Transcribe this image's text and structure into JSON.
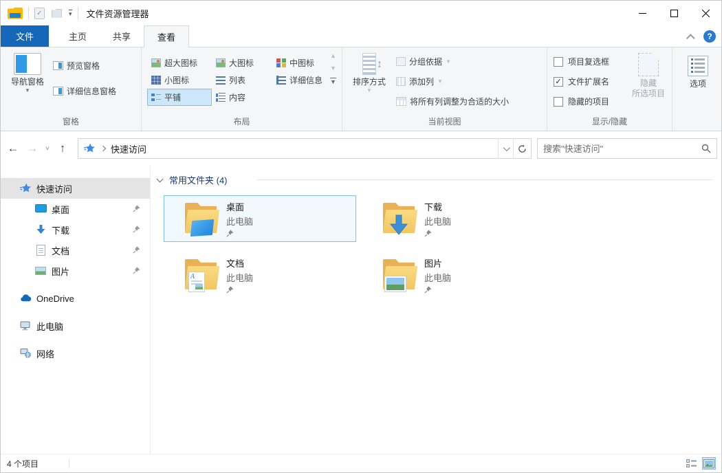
{
  "window": {
    "title": "文件资源管理器"
  },
  "tabs": {
    "file": "文件",
    "home": "主页",
    "share": "共享",
    "view": "查看"
  },
  "ribbon": {
    "panes": {
      "group_label": "窗格",
      "nav_pane": "导航窗格",
      "preview_pane": "预览窗格",
      "details_pane": "详细信息窗格"
    },
    "layout": {
      "group_label": "布局",
      "items": [
        {
          "label": "超大图标"
        },
        {
          "label": "大图标"
        },
        {
          "label": "中图标"
        },
        {
          "label": "小图标"
        },
        {
          "label": "列表"
        },
        {
          "label": "详细信息"
        },
        {
          "label": "平铺"
        },
        {
          "label": "内容"
        }
      ],
      "selected_item": "平铺"
    },
    "current_view": {
      "group_label": "当前视图",
      "sort_by": "排序方式",
      "group_by": "分组依据",
      "add_columns": "添加列",
      "size_columns": "将所有列调整为合适的大小"
    },
    "show_hide": {
      "group_label": "显示/隐藏",
      "item_checkboxes": {
        "label": "项目复选框",
        "checked": false
      },
      "file_extensions": {
        "label": "文件扩展名",
        "checked": true,
        "checkmark": "✓"
      },
      "hidden_items": {
        "label": "隐藏的项目",
        "checked": false
      },
      "hide_selected_line1": "隐藏",
      "hide_selected_line2": "所选项目"
    },
    "options_label": "选项"
  },
  "addressbar": {
    "location": "快速访问",
    "search_placeholder": "搜索\"快速访问\""
  },
  "sidebar": {
    "quick_access": "快速访问",
    "pinned": [
      {
        "label": "桌面"
      },
      {
        "label": "下载"
      },
      {
        "label": "文档"
      },
      {
        "label": "图片"
      }
    ],
    "onedrive": "OneDrive",
    "this_pc": "此电脑",
    "network": "网络"
  },
  "main": {
    "group_header": "常用文件夹 (4)",
    "tiles": [
      {
        "name": "桌面",
        "location": "此电脑",
        "selected": true
      },
      {
        "name": "下载",
        "location": "此电脑",
        "selected": false
      },
      {
        "name": "文档",
        "location": "此电脑",
        "selected": false
      },
      {
        "name": "图片",
        "location": "此电脑",
        "selected": false
      }
    ]
  },
  "statusbar": {
    "item_count": "4 个项目"
  },
  "colors": {
    "file_tab_blue": "#1467b9",
    "ribbon_bg": "#f5f6f7",
    "selected_view_bg": "#cce6fa",
    "selected_view_border": "#88bde6",
    "tile_selected_border": "#7cc0ee",
    "tile_selected_bg": "#f2f9fe",
    "sidebar_selected_bg": "#e4e4e4",
    "group_header_text": "#1e3c6e",
    "folder_yellow_front": "#f7d47c",
    "folder_yellow_back": "#e8b158",
    "accent_icon_blue": "#2e8de4",
    "help_circle_blue": "#2a7ad0"
  }
}
